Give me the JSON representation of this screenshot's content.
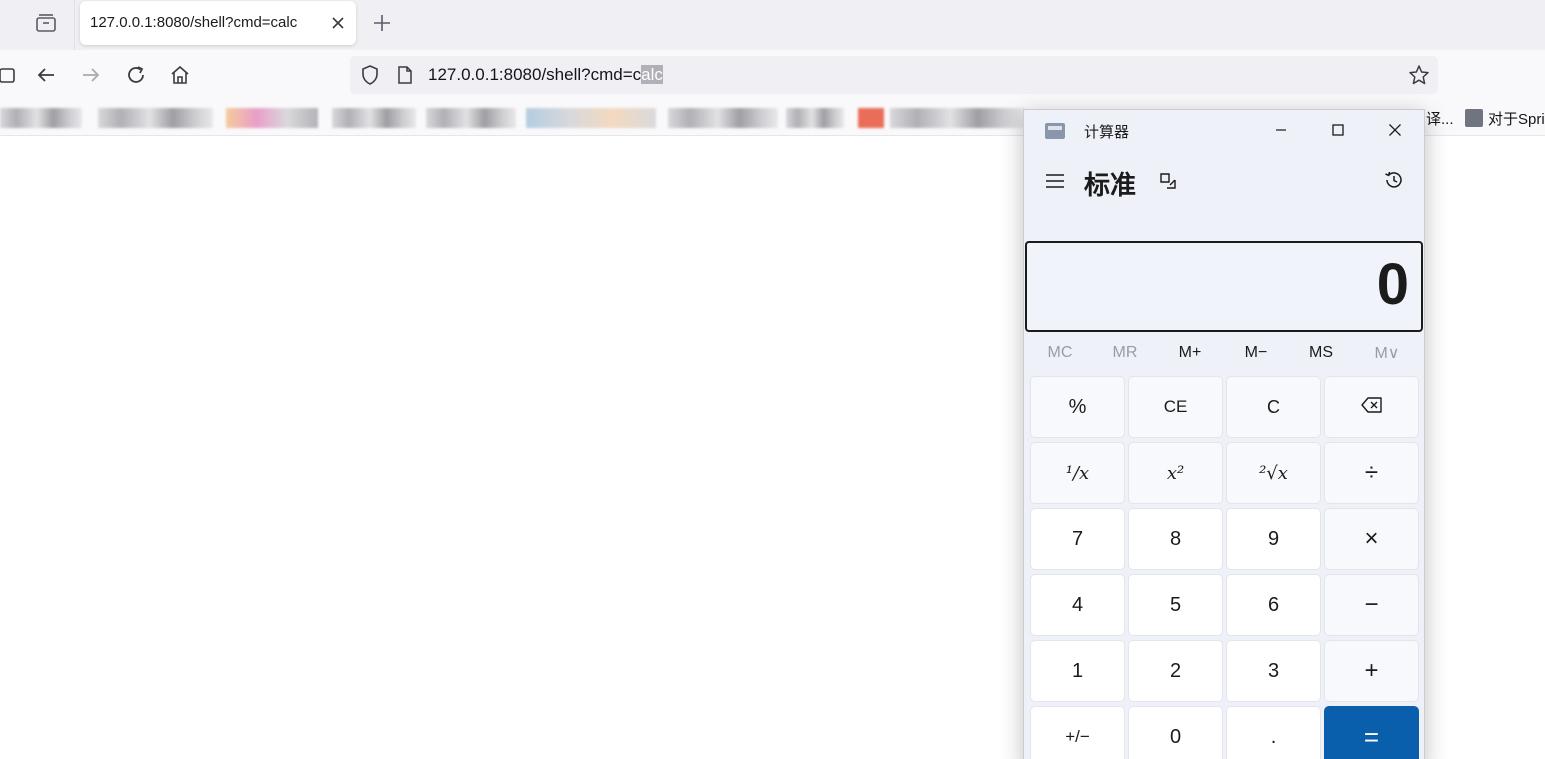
{
  "browser": {
    "tab_title": "127.0.0.1:8080/shell?cmd=calc",
    "url_prefix": "127.0.0.1:8080/shell?cmd=c",
    "url_selected": "alc",
    "bookmarks_visible_text": [
      "译...",
      "对于Spri"
    ]
  },
  "calculator": {
    "window_title": "计算器",
    "mode": "标准",
    "display_value": "0",
    "memory_buttons": [
      {
        "label": "MC",
        "enabled": false
      },
      {
        "label": "MR",
        "enabled": false
      },
      {
        "label": "M+",
        "enabled": true
      },
      {
        "label": "M−",
        "enabled": true
      },
      {
        "label": "MS",
        "enabled": true
      },
      {
        "label": "M∨",
        "enabled": false
      }
    ],
    "keys": {
      "percent": "%",
      "clear_entry": "CE",
      "clear": "C",
      "backspace": "⌫",
      "reciprocal": "¹/x",
      "square": "x²",
      "sqrt": "²√x",
      "divide": "÷",
      "seven": "7",
      "eight": "8",
      "nine": "9",
      "multiply": "×",
      "four": "4",
      "five": "5",
      "six": "6",
      "minus": "−",
      "one": "1",
      "two": "2",
      "three": "3",
      "plus": "+",
      "negate": "+/−",
      "zero": "0",
      "decimal": ".",
      "equals": "="
    }
  },
  "colors": {
    "equals_bg": "#0a5fad",
    "calc_bg": "#eef1f8",
    "chrome_bg": "#f0f0f4"
  }
}
